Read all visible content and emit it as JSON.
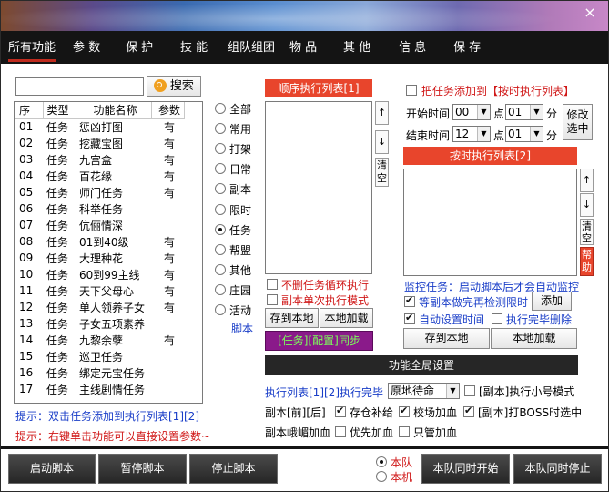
{
  "menu": [
    "所有功能",
    "参 数",
    "保 护",
    "技 能",
    "组队组团",
    "物 品",
    "其 他",
    "信 息",
    "保 存"
  ],
  "close_glyph": "×",
  "search": {
    "button": "搜索",
    "icon": "search-icon",
    "value": ""
  },
  "table": {
    "headers": [
      "序",
      "类型",
      "功能名称",
      "参数"
    ],
    "rows": [
      [
        "01",
        "任务",
        "惩凶打图",
        "有"
      ],
      [
        "02",
        "任务",
        "挖藏宝图",
        "有"
      ],
      [
        "03",
        "任务",
        "九宫盒",
        "有"
      ],
      [
        "04",
        "任务",
        "百花缘",
        "有"
      ],
      [
        "05",
        "任务",
        "师门任务",
        "有"
      ],
      [
        "06",
        "任务",
        "科举任务",
        ""
      ],
      [
        "07",
        "任务",
        "伉俪情深",
        ""
      ],
      [
        "08",
        "任务",
        "01到40级",
        "有"
      ],
      [
        "09",
        "任务",
        "大理种花",
        "有"
      ],
      [
        "10",
        "任务",
        "60到99主线",
        "有"
      ],
      [
        "11",
        "任务",
        "天下父母心",
        "有"
      ],
      [
        "12",
        "任务",
        "单人领养子女",
        "有"
      ],
      [
        "13",
        "任务",
        "子女五项素养",
        ""
      ],
      [
        "14",
        "任务",
        "九黎余孽",
        "有"
      ],
      [
        "15",
        "任务",
        "巡卫任务",
        ""
      ],
      [
        "16",
        "任务",
        "绑定元宝任务",
        ""
      ],
      [
        "17",
        "任务",
        "主线剧情任务",
        ""
      ]
    ]
  },
  "categories": [
    {
      "label": "全部",
      "selected": false
    },
    {
      "label": "常用",
      "selected": false
    },
    {
      "label": "打架",
      "selected": false
    },
    {
      "label": "日常",
      "selected": false
    },
    {
      "label": "副本",
      "selected": false
    },
    {
      "label": "限时",
      "selected": false
    },
    {
      "label": "任务",
      "selected": true
    },
    {
      "label": "帮盟",
      "selected": false
    },
    {
      "label": "其他",
      "selected": false
    },
    {
      "label": "庄园",
      "selected": false
    },
    {
      "label": "活动",
      "selected": false
    }
  ],
  "script_label": "脚本",
  "hints": {
    "line1": "提示：双击任务添加到执行列表[1][2]",
    "line2": "提示：右键单击功能可以直接设置参数~"
  },
  "seq_list": {
    "header": "顺序执行列表[1]",
    "up": "↑",
    "down": "↓",
    "clear": "清空",
    "no_delete_loop": "不删任务循环执行",
    "dungeon_single": "副本单次执行模式",
    "save_local": "存到本地",
    "load_local": "本地加载",
    "sync": "[任务][配置]同步"
  },
  "timed": {
    "add_to_timed": "把任务添加到【按时执行列表】",
    "start_label": "开始时间",
    "start_hour": "00",
    "start_min": "01",
    "end_label": "结束时间",
    "end_hour": "12",
    "end_min": "01",
    "point": "点",
    "minute": "分",
    "modify": "修改选中",
    "header": "按时执行列表[2]",
    "up": "↑",
    "down": "↓",
    "clear": "清空",
    "help": "帮助",
    "monitor": "监控任务：启动脚本后才会自动监控",
    "wait_dungeon": "等副本做完再检测限时",
    "add": "添加",
    "auto_time": "自动设置时间",
    "delete_after": "执行完毕删除",
    "save_local": "存到本地",
    "load_local": "本地加载"
  },
  "global": {
    "header": "功能全局设置",
    "exec_list_done": "执行列表[1][2]执行完毕",
    "done_action": "原地待命",
    "dungeon_small": "[副本]执行小号模式",
    "dungeon_front_back": "副本[前][后]",
    "restock": "存仓补给",
    "school_heal": "校场加血",
    "boss": "[副本]打BOSS时选中",
    "dungeon_heal": "副本峨嵋加血",
    "priority_heal": "优先加血",
    "only_heal": "只管加血"
  },
  "footer": {
    "start": "启动脚本",
    "pause": "暂停脚本",
    "stop": "停止脚本",
    "team_local": "本队",
    "team_machine": "本机",
    "team_start": "本队同时开始",
    "team_stop": "本队同时停止"
  }
}
